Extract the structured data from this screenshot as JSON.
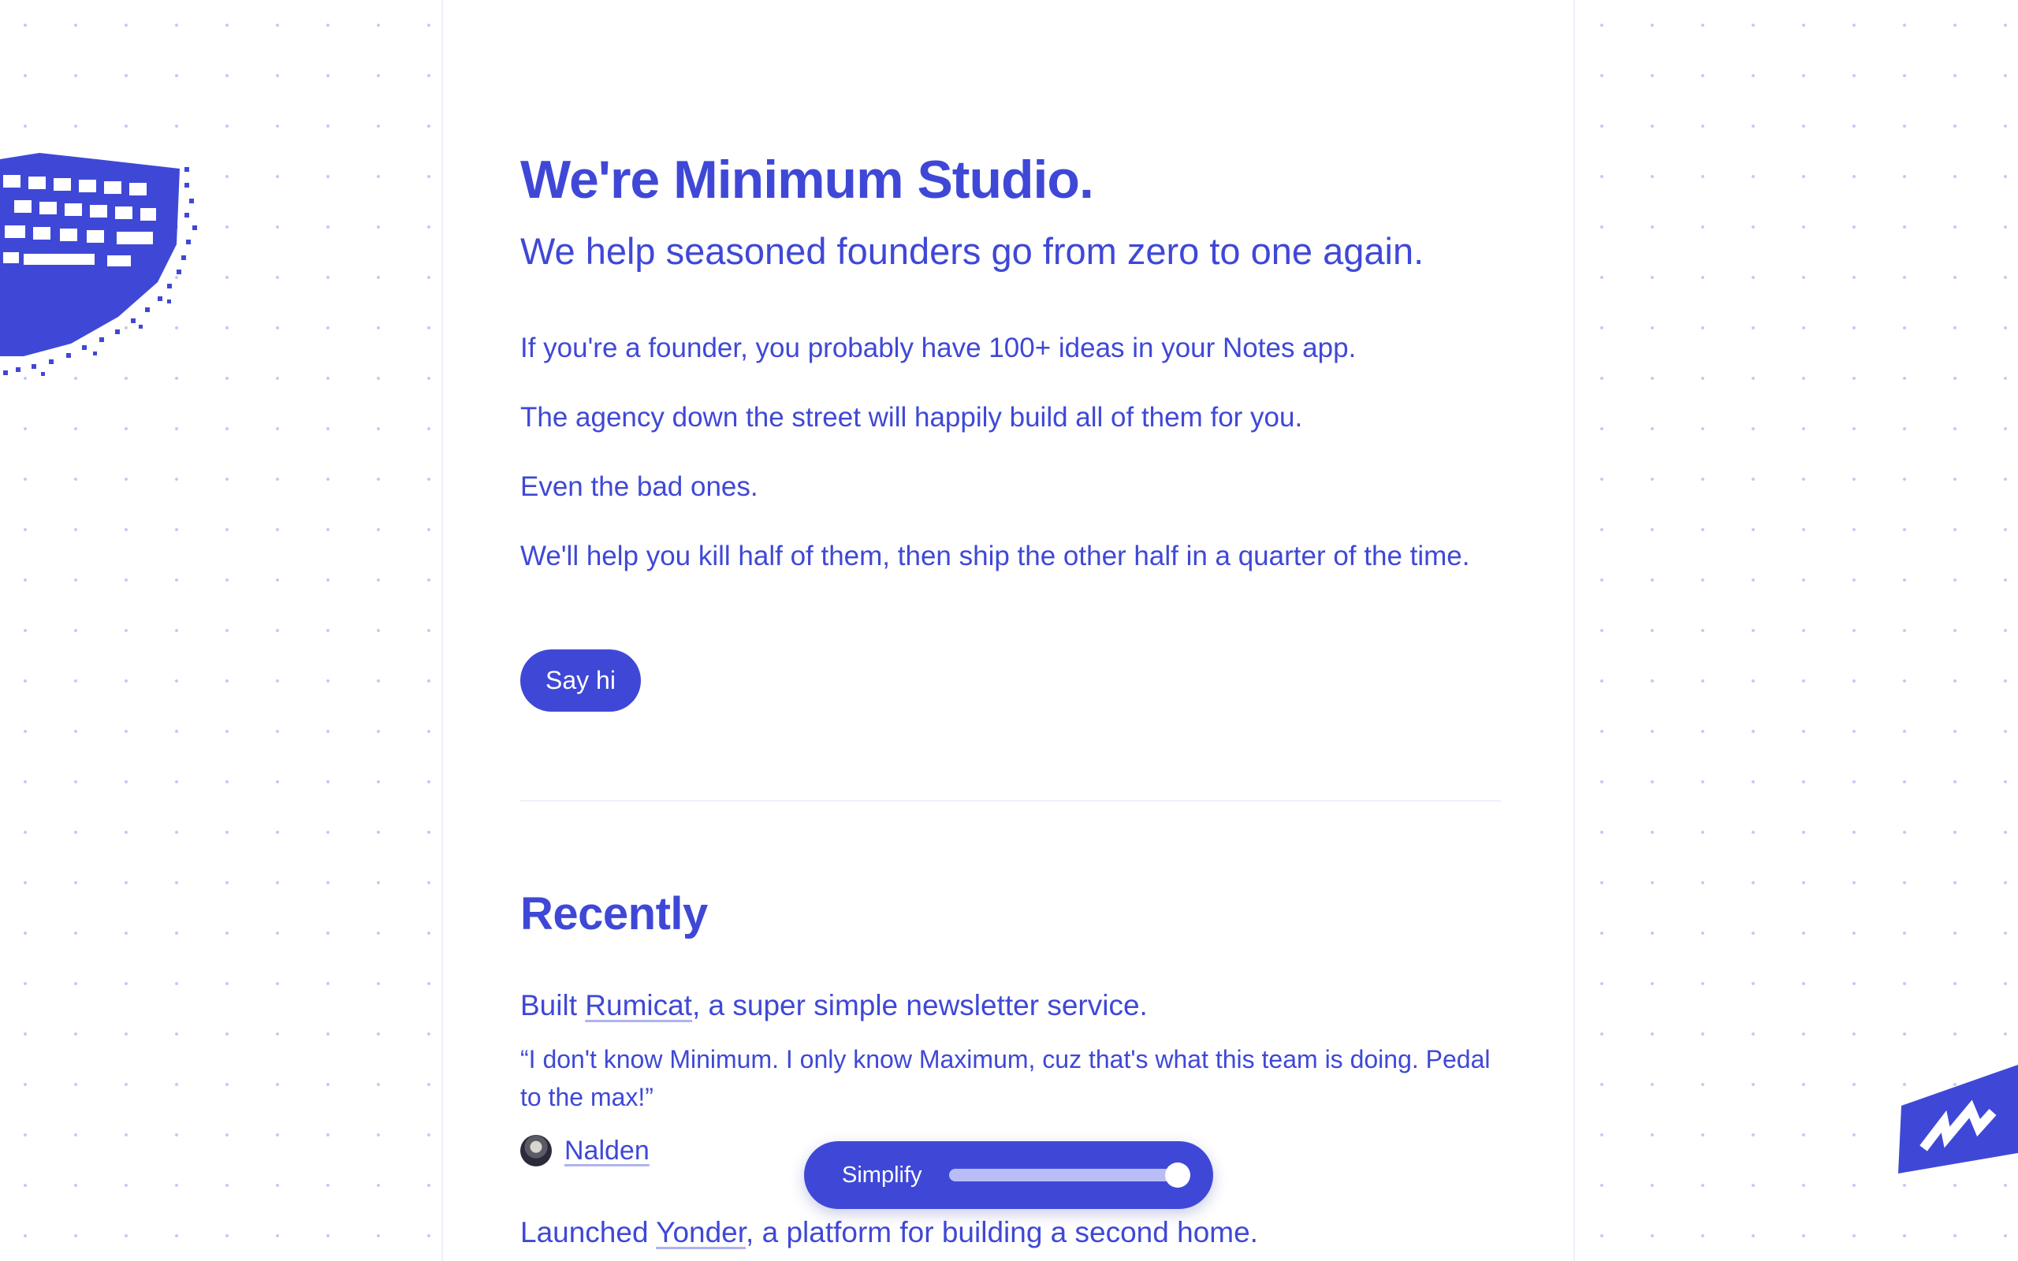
{
  "hero": {
    "title": "We're Minimum Studio.",
    "subtitle": "We help seasoned founders go from zero to one again.",
    "paragraphs": [
      "If you're a founder, you probably have 100+ ideas in your Notes app.",
      "The agency down the street will happily build all of them for you.",
      "Even the bad ones.",
      "We'll help you kill half of them, then ship the other half in a quarter of the time."
    ],
    "cta_label": "Say hi"
  },
  "recently": {
    "title": "Recently",
    "items": [
      {
        "prefix": "Built ",
        "link": "Rumicat",
        "suffix": ", a super simple newsletter service.",
        "quote": "“I don't know Minimum. I only know Maximum, cuz that's what this team is doing. Pedal to the max!”",
        "author": "Nalden"
      },
      {
        "prefix": "Launched ",
        "link": "Yonder",
        "suffix": ", a platform for building a second home."
      }
    ]
  },
  "simplify": {
    "label": "Simplify",
    "level_percent": 100
  },
  "decorations": {
    "left": "pixel-keyboard-icon",
    "right": "pixel-shoe-icon"
  },
  "colors": {
    "accent": "#3f48d6",
    "dots": "#c5c9f2",
    "background": "#ffffff"
  }
}
